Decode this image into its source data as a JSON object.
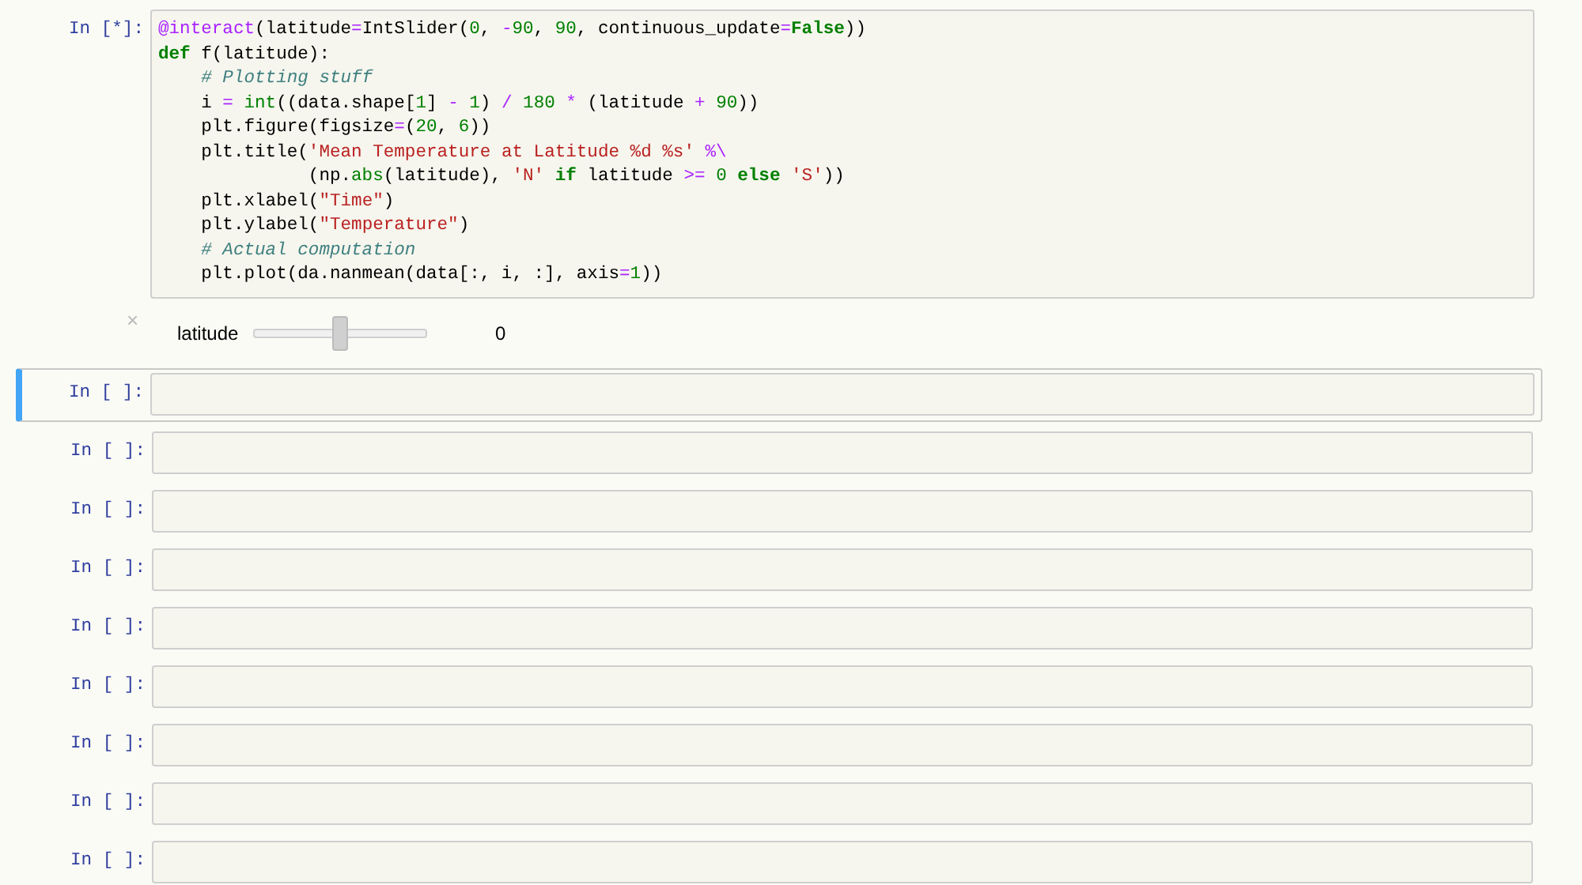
{
  "code_cell": {
    "prompt": "In [*]:",
    "lines": [
      [
        {
          "kind": "decorator",
          "text": "@interact"
        },
        {
          "kind": "plain",
          "text": "(latitude"
        },
        {
          "kind": "op",
          "text": "="
        },
        {
          "kind": "plain",
          "text": "IntSlider("
        },
        {
          "kind": "num",
          "text": "0"
        },
        {
          "kind": "plain",
          "text": ", "
        },
        {
          "kind": "op",
          "text": "-"
        },
        {
          "kind": "num",
          "text": "90"
        },
        {
          "kind": "plain",
          "text": ", "
        },
        {
          "kind": "num",
          "text": "90"
        },
        {
          "kind": "plain",
          "text": ", continuous_update"
        },
        {
          "kind": "op",
          "text": "="
        },
        {
          "kind": "kw",
          "text": "False"
        },
        {
          "kind": "plain",
          "text": "))"
        }
      ],
      [
        {
          "kind": "kw",
          "text": "def"
        },
        {
          "kind": "plain",
          "text": " f(latitude):"
        }
      ],
      [
        {
          "kind": "comment",
          "text": "    # Plotting stuff"
        }
      ],
      [
        {
          "kind": "plain",
          "text": "    i"
        },
        {
          "kind": "op",
          "text": " = "
        },
        {
          "kind": "builtin",
          "text": "int"
        },
        {
          "kind": "plain",
          "text": "((data.shape["
        },
        {
          "kind": "num",
          "text": "1"
        },
        {
          "kind": "plain",
          "text": "]"
        },
        {
          "kind": "op",
          "text": " - "
        },
        {
          "kind": "num",
          "text": "1"
        },
        {
          "kind": "plain",
          "text": ")"
        },
        {
          "kind": "op",
          "text": " / "
        },
        {
          "kind": "num",
          "text": "180"
        },
        {
          "kind": "op",
          "text": " * "
        },
        {
          "kind": "plain",
          "text": "(latitude"
        },
        {
          "kind": "op",
          "text": " + "
        },
        {
          "kind": "num",
          "text": "90"
        },
        {
          "kind": "plain",
          "text": "))"
        }
      ],
      [
        {
          "kind": "plain",
          "text": "    plt.figure(figsize"
        },
        {
          "kind": "op",
          "text": "="
        },
        {
          "kind": "plain",
          "text": "("
        },
        {
          "kind": "num",
          "text": "20"
        },
        {
          "kind": "plain",
          "text": ", "
        },
        {
          "kind": "num",
          "text": "6"
        },
        {
          "kind": "plain",
          "text": "))"
        }
      ],
      [
        {
          "kind": "plain",
          "text": "    plt.title("
        },
        {
          "kind": "str",
          "text": "'Mean Temperature at Latitude %d %s'"
        },
        {
          "kind": "op",
          "text": " %\\"
        }
      ],
      [
        {
          "kind": "plain",
          "text": "              (np."
        },
        {
          "kind": "builtin",
          "text": "abs"
        },
        {
          "kind": "plain",
          "text": "(latitude), "
        },
        {
          "kind": "str",
          "text": "'N'"
        },
        {
          "kind": "kw",
          "text": " if"
        },
        {
          "kind": "plain",
          "text": " latitude"
        },
        {
          "kind": "op",
          "text": " >= "
        },
        {
          "kind": "num",
          "text": "0"
        },
        {
          "kind": "kw",
          "text": " else "
        },
        {
          "kind": "str",
          "text": "'S'"
        },
        {
          "kind": "plain",
          "text": "))"
        }
      ],
      [
        {
          "kind": "plain",
          "text": "    plt.xlabel("
        },
        {
          "kind": "str",
          "text": "\"Time\""
        },
        {
          "kind": "plain",
          "text": ")"
        }
      ],
      [
        {
          "kind": "plain",
          "text": "    plt.ylabel("
        },
        {
          "kind": "str",
          "text": "\"Temperature\""
        },
        {
          "kind": "plain",
          "text": ")"
        }
      ],
      [
        {
          "kind": "comment",
          "text": "    # Actual computation"
        }
      ],
      [
        {
          "kind": "plain",
          "text": "    plt.plot(da.nanmean(data[:, i, :], axis"
        },
        {
          "kind": "op",
          "text": "="
        },
        {
          "kind": "num",
          "text": "1"
        },
        {
          "kind": "plain",
          "text": "))"
        }
      ]
    ]
  },
  "widget": {
    "close": "×",
    "label": "latitude",
    "level": 0.5,
    "reading": "0"
  },
  "cells": [
    {
      "prompt": "In [ ]:",
      "selected": true
    },
    {
      "prompt": "In [ ]:",
      "selected": false
    },
    {
      "prompt": "In [ ]:",
      "selected": false
    },
    {
      "prompt": "In [ ]:",
      "selected": false
    },
    {
      "prompt": "In [ ]:",
      "selected": false
    },
    {
      "prompt": "In [ ]:",
      "selected": false
    },
    {
      "prompt": "In [ ]:",
      "selected": false
    },
    {
      "prompt": "In [ ]:",
      "selected": false
    },
    {
      "prompt": "In [ ]:",
      "selected": false
    }
  ]
}
